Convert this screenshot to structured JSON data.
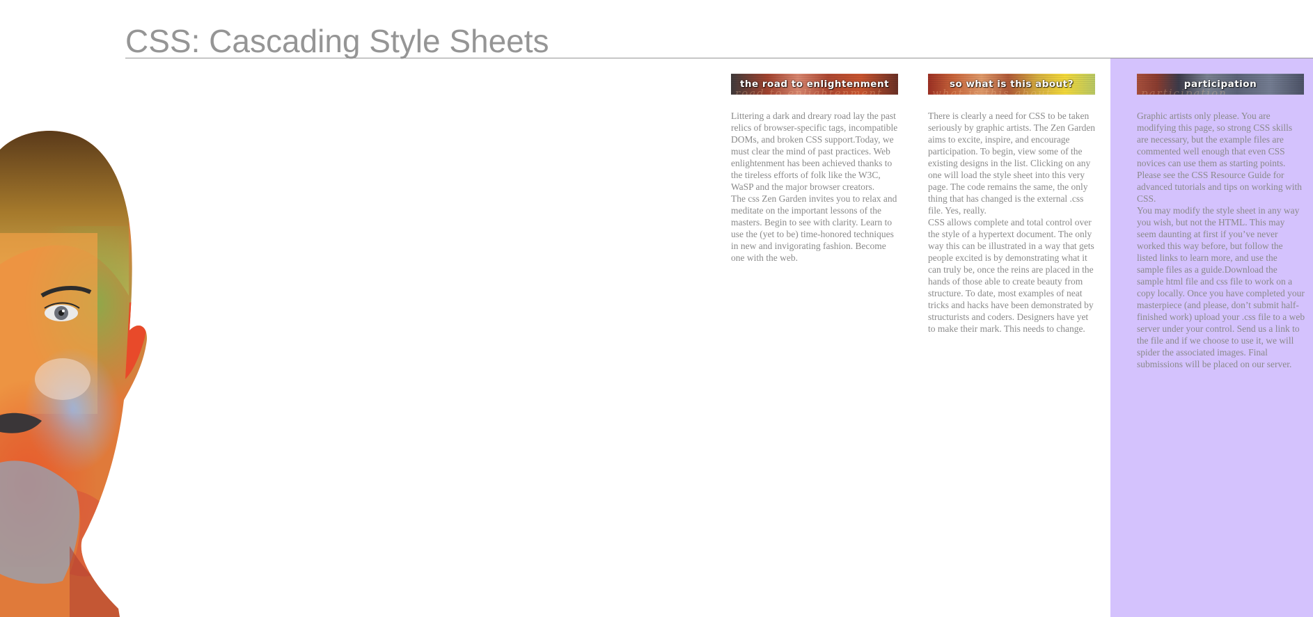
{
  "header": {
    "title": "CSS: Cascading Style Sheets"
  },
  "portrait": {
    "icon": "face-paint-portrait"
  },
  "colors": {
    "title_text": "#959595",
    "body_text": "#8a8a8a",
    "sidebar_background": "#d4c2fd",
    "page_background": "#ffffff"
  },
  "sections": [
    {
      "banner_label": "the road to enlightenment",
      "banner_ghost": "road to enlightenment",
      "paragraphs": [
        "Littering a dark and dreary road lay the past relics of browser-specific tags, incompatible DOMs, and broken CSS support.Today, we must clear the mind of past practices. Web enlightenment has been achieved thanks to the tireless efforts of folk like the W3C, WaSP and the major browser creators.",
        "The css Zen Garden invites you to relax and meditate on the important lessons of the masters. Begin to see with clarity. Learn to use the (yet to be) time-honored techniques in new and invigorating fashion. Become one with the web."
      ]
    },
    {
      "banner_label": "so what is this about?",
      "banner_ghost": "what is this about",
      "paragraphs": [
        "There is clearly a need for CSS to be taken seriously by graphic artists. The Zen Garden aims to excite, inspire, and encourage participation. To begin, view some of the existing designs in the list. Clicking on any one will load the style sheet into this very page. The code remains the same, the only thing that has changed is the external .css file. Yes, really.",
        "CSS allows complete and total control over the style of a hypertext document. The only way this can be illustrated in a way that gets people excited is by demonstrating what it can truly be, once the reins are placed in the hands of those able to create beauty from structure. To date, most examples of neat tricks and hacks have been demonstrated by structurists and coders. Designers have yet to make their mark. This needs to change."
      ]
    },
    {
      "banner_label": "participation",
      "banner_ghost": "participation",
      "paragraphs": [
        "Graphic artists only please. You are modifying this page, so strong CSS skills are necessary, but the example files are commented well enough that even CSS novices can use them as starting points. Please see the CSS Resource Guide for advanced tutorials and tips on working with CSS.",
        "You may modify the style sheet in any way you wish, but not the HTML. This may seem daunting at first if you’ve never worked this way before, but follow the listed links to learn more, and use the sample files as a guide.Download the sample html file and css file to work on a copy locally. Once you have completed your masterpiece (and please, don’t submit half-finished work) upload your .css file to a web server under your control. Send us a link to the file and if we choose to use it, we will spider the associated images. Final submissions will be placed on our server."
      ]
    }
  ]
}
